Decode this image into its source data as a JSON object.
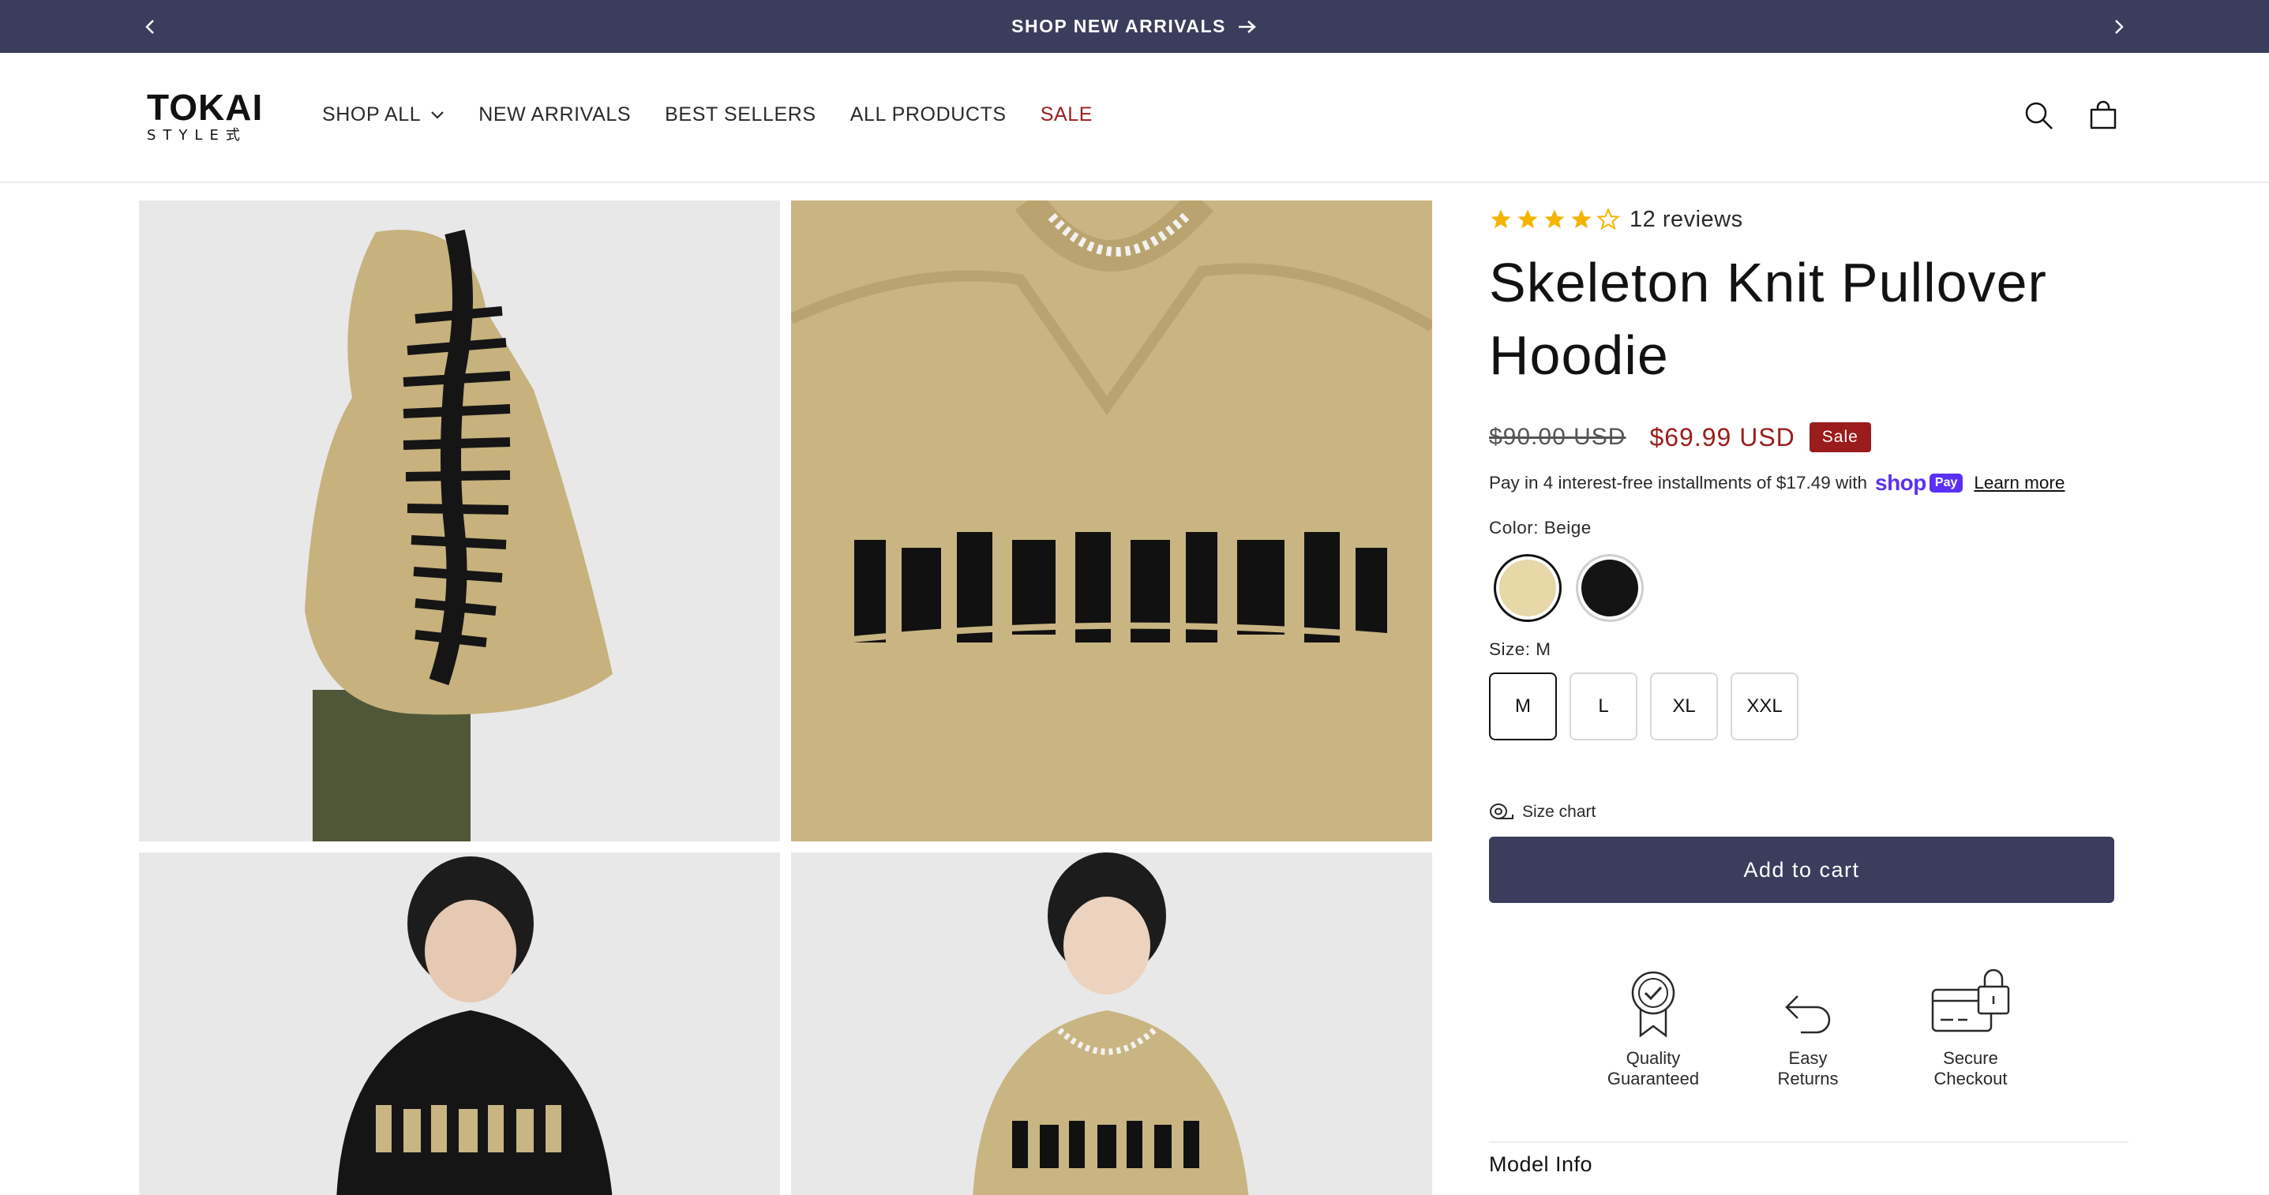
{
  "announcement": {
    "message": "SHOP NEW ARRIVALS"
  },
  "brand": {
    "logo_text": "TOKAI",
    "logo_subtext": "STYLE式"
  },
  "nav": {
    "items": [
      {
        "label": "SHOP ALL"
      },
      {
        "label": "NEW ARRIVALS"
      },
      {
        "label": "BEST SELLERS"
      },
      {
        "label": "ALL PRODUCTS"
      },
      {
        "label": "SALE"
      }
    ]
  },
  "gallery": {
    "images": [
      {
        "icon": "hoodie-back-image"
      },
      {
        "icon": "hoodie-front-closeup-image"
      },
      {
        "icon": "model-black-hoodie-image"
      },
      {
        "icon": "model-beige-hoodie-image"
      }
    ]
  },
  "product": {
    "rating_value": 4.5,
    "rating_max": 5,
    "reviews_label": "12 reviews",
    "title": "Skeleton Knit Pullover Hoodie",
    "price_old": "$90.00 USD",
    "price_new": "$69.99 USD",
    "sale_badge": "Sale",
    "installments_text": "Pay in 4 interest-free installments of $17.49 with",
    "shop_pay_brand": "shop",
    "shop_pay_pill": "Pay",
    "learn_more": "Learn more",
    "color_label": "Color: Beige",
    "colors": [
      {
        "name": "Beige",
        "hex": "#e8d7a7",
        "selected": true
      },
      {
        "name": "Black",
        "hex": "#141414",
        "selected": false
      }
    ],
    "size_label": "Size: M",
    "sizes": [
      {
        "label": "M",
        "selected": true
      },
      {
        "label": "L",
        "selected": false
      },
      {
        "label": "XL",
        "selected": false
      },
      {
        "label": "XXL",
        "selected": false
      }
    ],
    "size_chart_label": "Size chart",
    "add_to_cart_label": "Add to cart"
  },
  "trust_badges": [
    {
      "line1": "Quality",
      "line2": "Guaranteed"
    },
    {
      "line1": "Easy",
      "line2": "Returns"
    },
    {
      "line1": "Secure",
      "line2": "Checkout"
    }
  ],
  "accordion": {
    "model_info_label": "Model Info"
  },
  "colors": {
    "accent": "#3a3d5c",
    "sale": "#9b1c1c",
    "star": "#f4b400",
    "shop_pay": "#5a31f4"
  }
}
